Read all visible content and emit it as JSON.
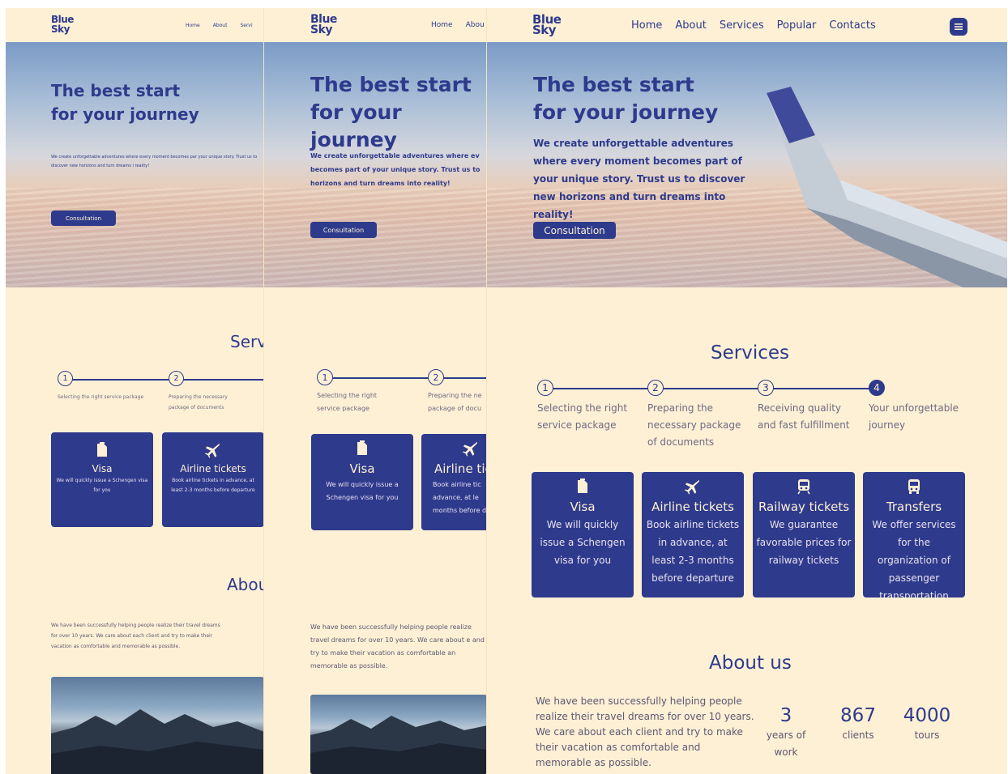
{
  "brand": {
    "line1": "Blue",
    "line2": "Sky"
  },
  "nav": {
    "home": "Home",
    "about": "About",
    "services": "Services",
    "popular": "Popular",
    "contacts": "Contacts",
    "p1_services_cut": "Servi",
    "p2_about_cut": "Abou"
  },
  "hero": {
    "title_line1": "The best start",
    "title_line2": "for your journey",
    "description": "We create unforgettable adventures where every moment becomes part of your unique story. Trust us to discover new horizons and turn dreams into reality!",
    "p1_desc": "We create unforgettable adventures where every moment becomes par your unique story. Trust us to discover new horizons and turn dreams i reality!",
    "p2_desc": "We create unforgettable adventures where ev becomes part of your unique story. Trust us to horizons and turn dreams into reality!",
    "cta": "Consultation"
  },
  "services": {
    "title": "Services",
    "p1_title": "Serv",
    "steps": [
      {
        "num": "1",
        "text": "Selecting the right service package"
      },
      {
        "num": "2",
        "text": "Preparing the necessary package of documents"
      },
      {
        "num": "3",
        "text": "Receiving quality and fast fulfillment"
      },
      {
        "num": "4",
        "text": "Your unforgettable journey"
      }
    ],
    "p1_steps": [
      {
        "num": "1",
        "text": "Selecting the right service package"
      },
      {
        "num": "2",
        "text": "Preparing the necessary package of documents"
      }
    ],
    "p2_steps": [
      {
        "num": "1",
        "text": "Selecting the right service package"
      },
      {
        "num": "2",
        "text": "Preparing the ne package of docu"
      }
    ],
    "cards": [
      {
        "title": "Visa",
        "desc": "We will quickly issue a Schengen visa for you",
        "icon": "document-icon"
      },
      {
        "title": "Airline tickets",
        "desc": "Book airline tickets in advance, at least 2-3 months before departure",
        "icon": "airplane-icon"
      },
      {
        "title": "Railway tickets",
        "desc": "We guarantee favorable prices for railway tickets",
        "icon": "train-icon"
      },
      {
        "title": "Transfers",
        "desc": "We offer services for the organization of passenger transportation",
        "icon": "bus-icon"
      }
    ],
    "p1_cards": [
      {
        "title": "Visa",
        "desc": "We will quickly issue a Schengen visa for you"
      },
      {
        "title": "Airline tickets",
        "desc": "Book airline tickets in advance, at least 2-3 months before departure"
      }
    ],
    "p2_cards": [
      {
        "title": "Visa",
        "desc": "We will quickly issue a Schengen visa for you"
      },
      {
        "title": "Airline tic",
        "desc": "Book airline tic advance, at le months before d"
      }
    ]
  },
  "about": {
    "title": "About us",
    "p1_title": "Abou",
    "text": "We have been successfully helping people realize their travel dreams for over 10 years. We care about each client and try to make their vacation as comfortable and memorable as possible.",
    "p2_text": "We have been successfully helping people realize travel dreams for over 10 years. We care about e and try to make their vacation as comfortable an memorable as possible.",
    "stats": [
      {
        "value": "3",
        "label": "years of work"
      },
      {
        "value": "867",
        "label": "clients"
      },
      {
        "value": "4000",
        "label": "tours"
      }
    ]
  },
  "colors": {
    "primary": "#2e3a8c",
    "background": "#fdf0d5"
  }
}
